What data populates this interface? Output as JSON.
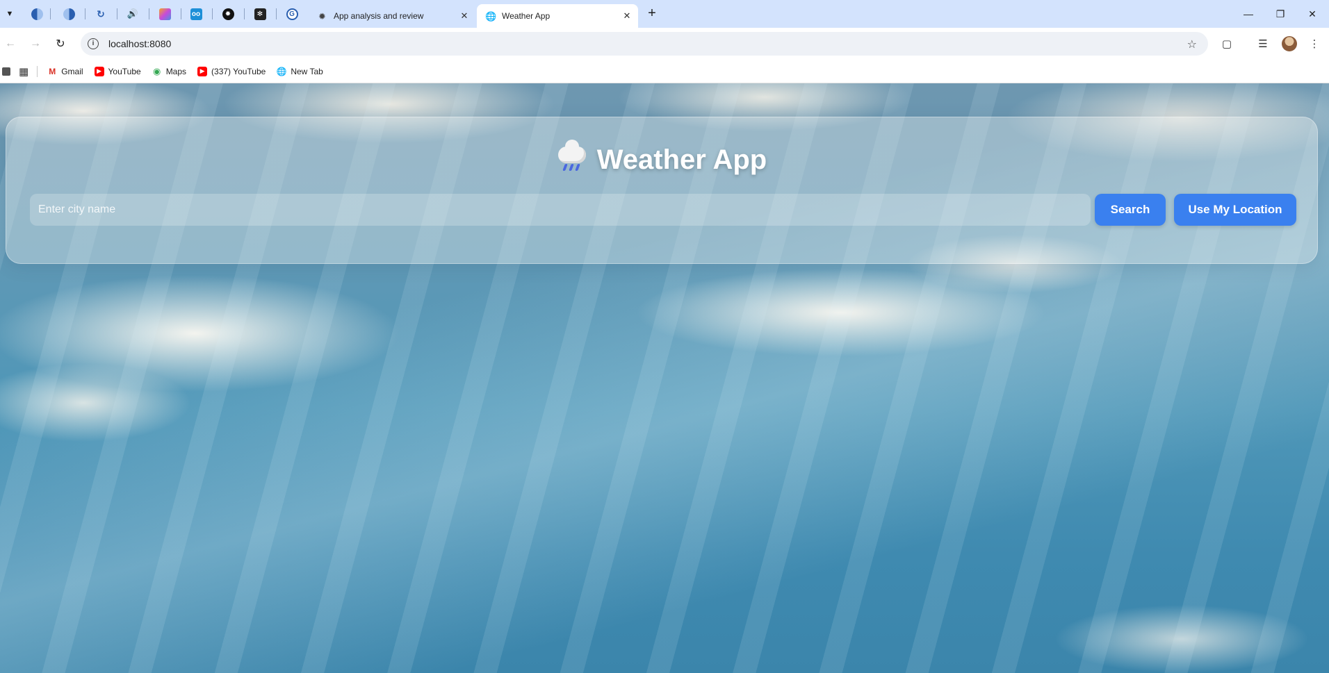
{
  "browser": {
    "tabs": [
      {
        "title": "App analysis and review",
        "icon": "openai-icon",
        "active": false
      },
      {
        "title": "Weather App",
        "icon": "globe-icon",
        "active": true
      }
    ],
    "address": "localhost:8080",
    "bookmarks": [
      {
        "label": "Gmail",
        "icon": "gmail-icon"
      },
      {
        "label": "YouTube",
        "icon": "youtube-icon"
      },
      {
        "label": "Maps",
        "icon": "maps-icon"
      },
      {
        "label": "(337) YouTube",
        "icon": "youtube-icon"
      },
      {
        "label": "New Tab",
        "icon": "globe-icon"
      }
    ]
  },
  "app": {
    "title": "Weather App",
    "search": {
      "placeholder": "Enter city name",
      "value": ""
    },
    "buttons": {
      "search": "Search",
      "location": "Use My Location"
    },
    "colors": {
      "accent": "#3a80ef",
      "sky": "#4f97b8"
    }
  }
}
